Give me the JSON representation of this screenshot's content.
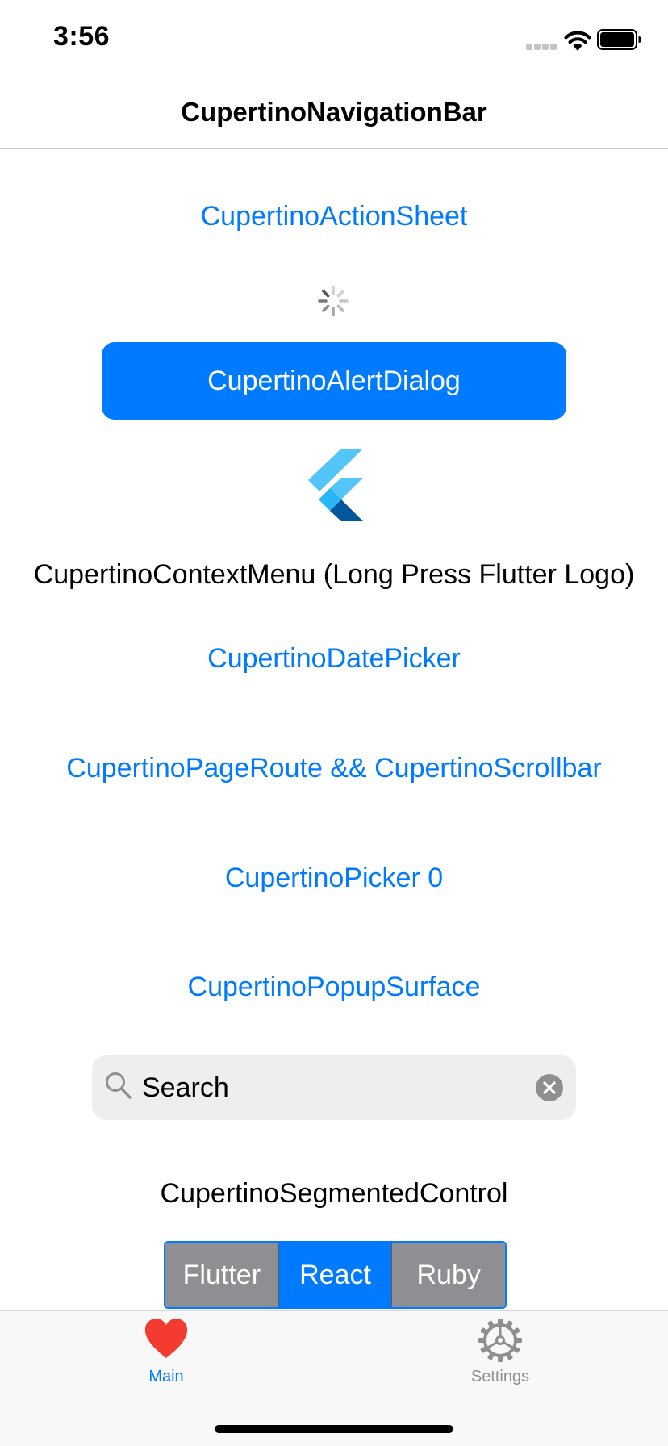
{
  "status_bar": {
    "time": "3:56"
  },
  "nav_bar": {
    "title": "CupertinoNavigationBar"
  },
  "main": {
    "action_sheet_label": "CupertinoActionSheet",
    "alert_dialog_label": "CupertinoAlertDialog",
    "context_menu_label": "CupertinoContextMenu (Long Press Flutter Logo)",
    "date_picker_label": "CupertinoDatePicker",
    "page_route_label": "CupertinoPageRoute && CupertinoScrollbar",
    "picker_label": "CupertinoPicker 0",
    "popup_surface_label": "CupertinoPopupSurface",
    "search": {
      "placeholder": "Search",
      "value": ""
    },
    "segmented_control_label": "CupertinoSegmentedControl",
    "segments": [
      "Flutter",
      "React",
      "Ruby"
    ],
    "selected_segment": "React"
  },
  "tab_bar": {
    "tabs": [
      {
        "label": "Main",
        "icon": "heart-icon",
        "active": true
      },
      {
        "label": "Settings",
        "icon": "gear-icon",
        "active": false
      }
    ]
  },
  "colors": {
    "accent": "#007aff",
    "segment_unselected": "#8e8e93",
    "heart": "#f43b30",
    "search_background": "#eeeeef"
  }
}
